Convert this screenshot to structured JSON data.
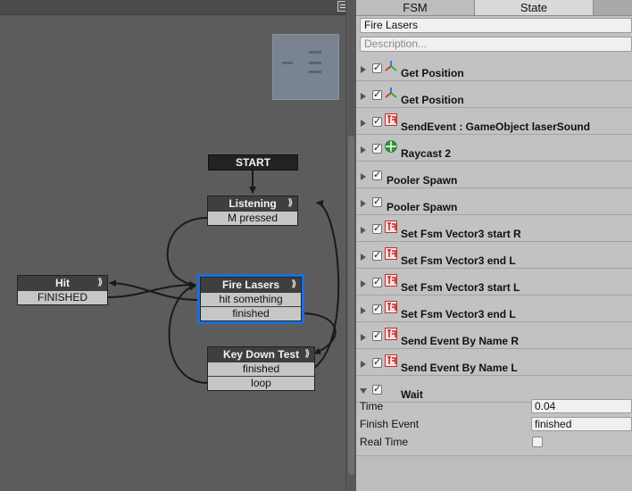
{
  "graph": {
    "start_label": "START",
    "nodes": {
      "listening": {
        "title": "Listening",
        "events": [
          "M pressed"
        ]
      },
      "hit": {
        "title": "Hit",
        "events": [
          "FINISHED"
        ]
      },
      "fire_lasers": {
        "title": "Fire Lasers",
        "events": [
          "hit something",
          "finished"
        ]
      },
      "key_down_test": {
        "title": "Key Down Test",
        "events": [
          "finished",
          "loop"
        ]
      }
    },
    "transition_glyph": "⟫"
  },
  "inspector": {
    "tabs": [
      "FSM",
      "State"
    ],
    "state_name": "Fire Lasers",
    "description_placeholder": "Description...",
    "actions": [
      {
        "label": "Get Position",
        "icon": "transform-axes-icon",
        "enabled": true
      },
      {
        "label": "Get Position",
        "icon": "transform-axes-icon",
        "enabled": true
      },
      {
        "label": "SendEvent : GameObject laserSound",
        "icon": "playmaker-action-icon",
        "enabled": true
      },
      {
        "label": "Raycast 2",
        "icon": "physics-globe-icon",
        "enabled": true
      },
      {
        "label": "Pooler Spawn",
        "icon": "none",
        "enabled": true
      },
      {
        "label": "Pooler Spawn",
        "icon": "none",
        "enabled": true
      },
      {
        "label": "Set Fsm Vector3 start R",
        "icon": "playmaker-action-icon",
        "enabled": true
      },
      {
        "label": "Set Fsm Vector3 end L",
        "icon": "playmaker-action-icon",
        "enabled": true
      },
      {
        "label": "Set Fsm Vector3 start L",
        "icon": "playmaker-action-icon",
        "enabled": true
      },
      {
        "label": "Set Fsm Vector3 end L",
        "icon": "playmaker-action-icon",
        "enabled": true
      },
      {
        "label": "Send Event By Name R",
        "icon": "playmaker-action-icon",
        "enabled": true
      },
      {
        "label": "Send Event By Name L",
        "icon": "playmaker-action-icon",
        "enabled": true
      },
      {
        "label": "Wait",
        "icon": "none",
        "enabled": true,
        "expanded": true
      }
    ],
    "wait_props": {
      "time_label": "Time",
      "time_value": "0.04",
      "finish_event_label": "Finish Event",
      "finish_event_value": "finished",
      "real_time_label": "Real Time",
      "real_time_checked": false
    }
  },
  "colors": {
    "selection": "#1e6fd6",
    "graph_bg": "#5c5c5c",
    "inspector_bg": "#c2c2c2"
  }
}
